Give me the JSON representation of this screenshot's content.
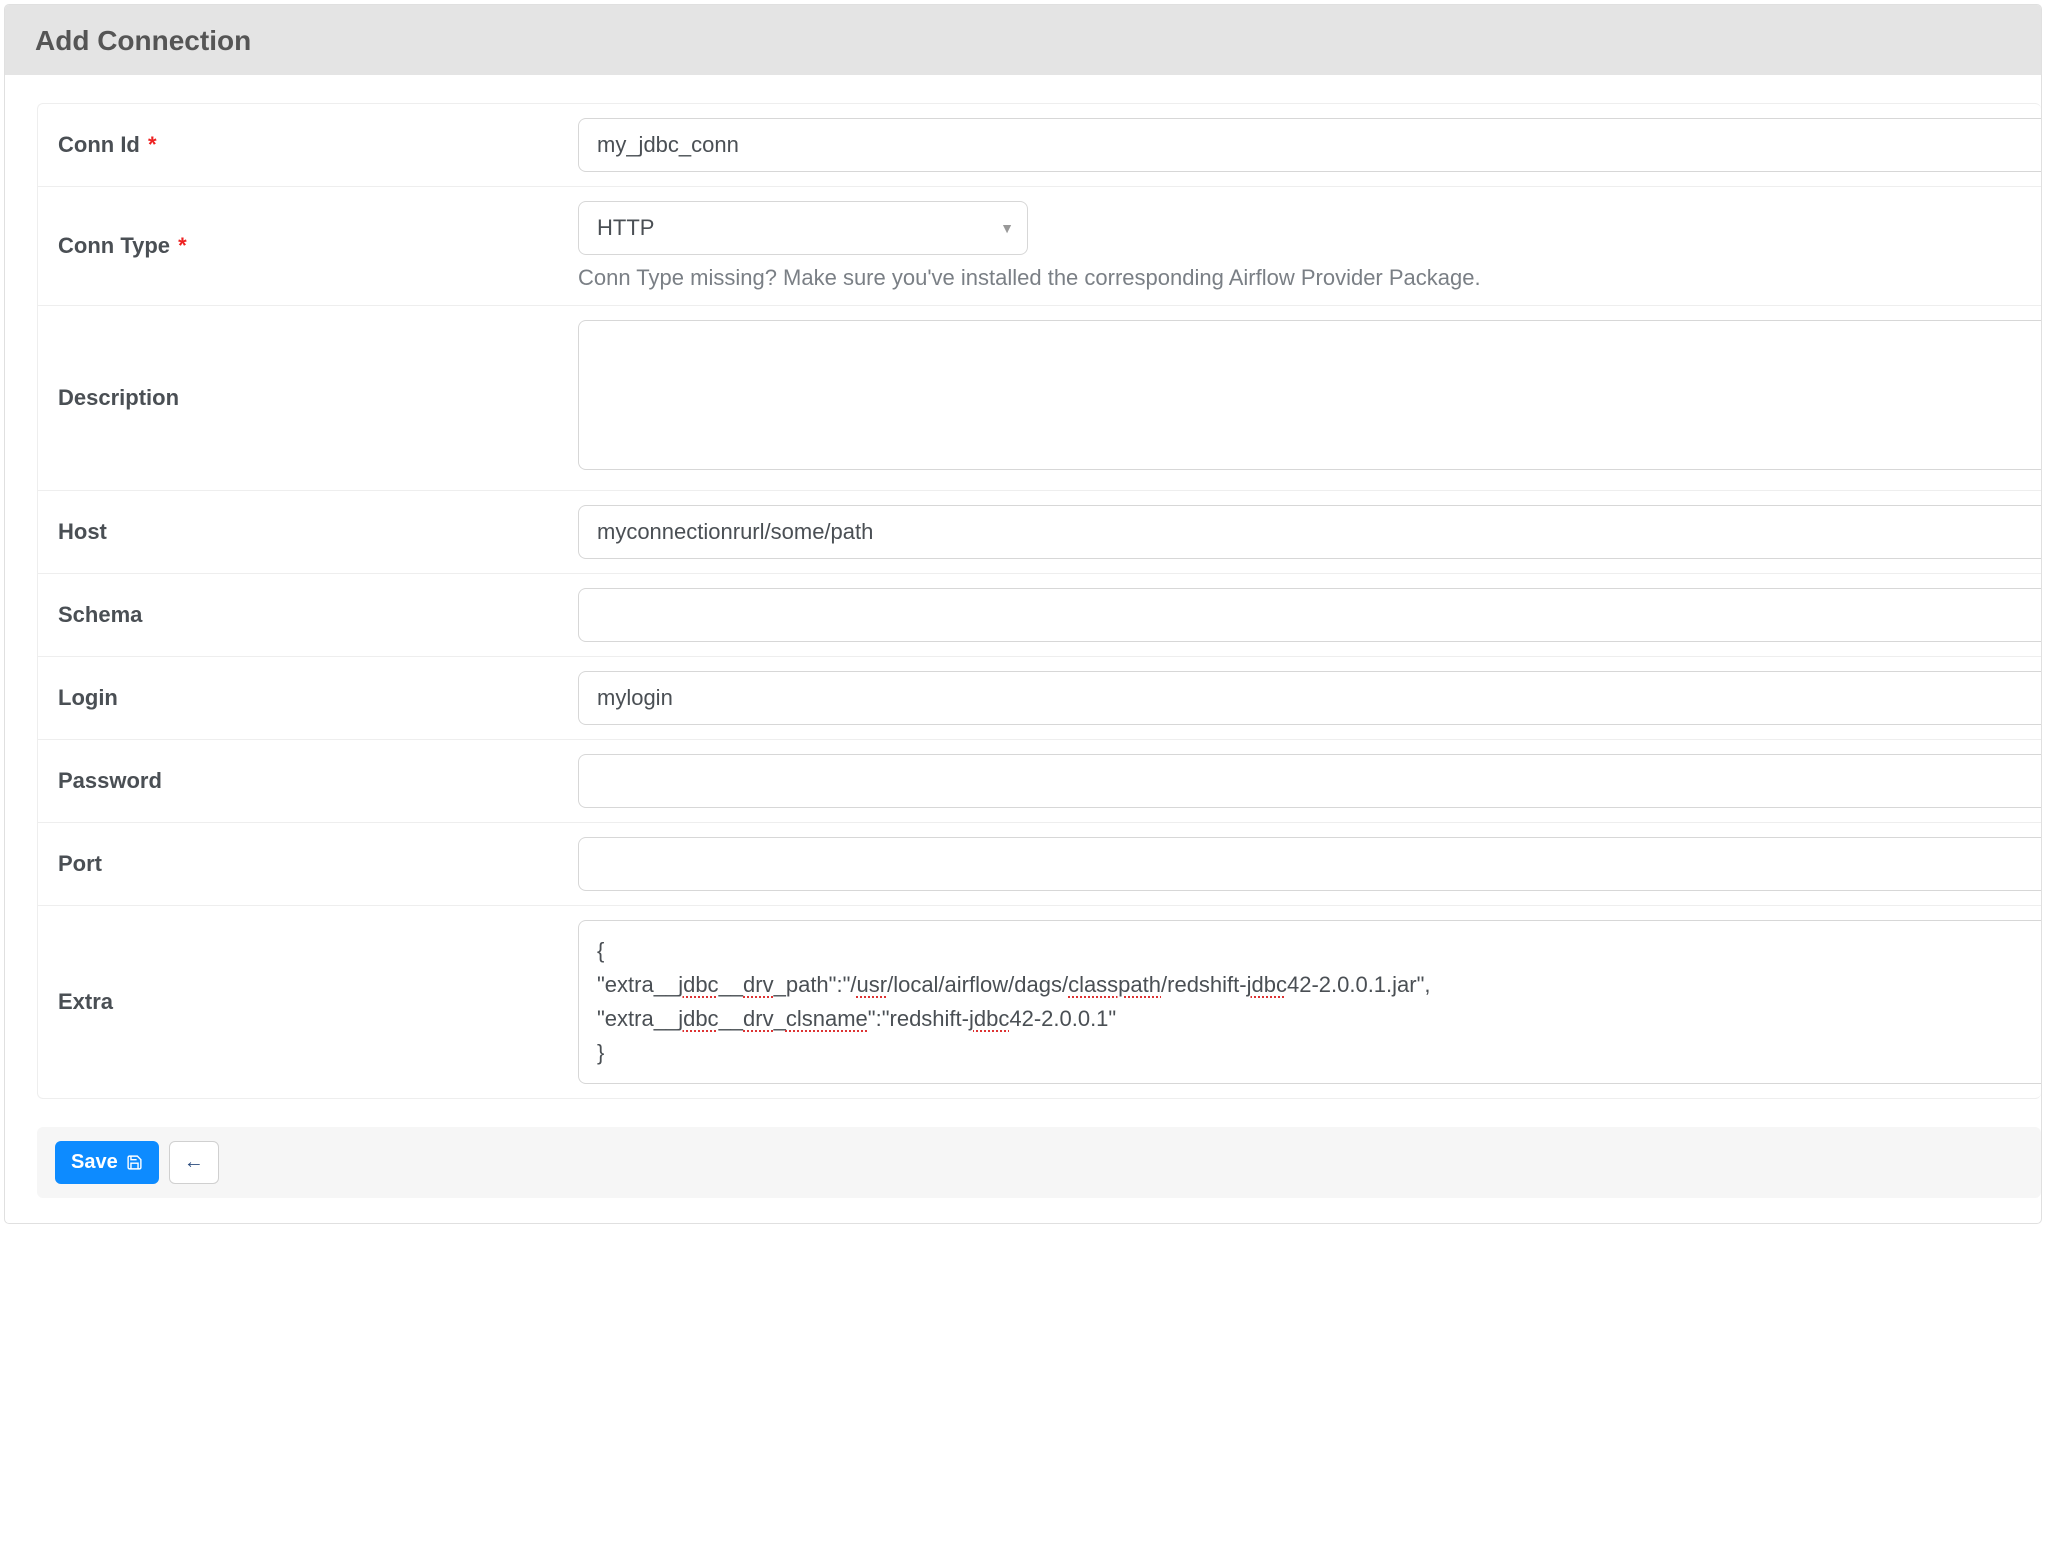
{
  "header": {
    "title": "Add Connection"
  },
  "fields": {
    "conn_id": {
      "label": "Conn Id",
      "required": true,
      "value": "my_jdbc_conn"
    },
    "conn_type": {
      "label": "Conn Type",
      "required": true,
      "value": "HTTP",
      "help": "Conn Type missing? Make sure you've installed the corresponding Airflow Provider Package."
    },
    "description": {
      "label": "Description",
      "required": false,
      "value": ""
    },
    "host": {
      "label": "Host",
      "required": false,
      "value": "myconnectionrurl/some/path"
    },
    "schema": {
      "label": "Schema",
      "required": false,
      "value": ""
    },
    "login": {
      "label": "Login",
      "required": false,
      "value": "mylogin"
    },
    "password": {
      "label": "Password",
      "required": false,
      "value": ""
    },
    "port": {
      "label": "Port",
      "required": false,
      "value": ""
    },
    "extra": {
      "label": "Extra",
      "required": false,
      "value": "{\n\"extra__jdbc__drv_path\":\"/usr/local/airflow/dags/classpath/redshift-jdbc42-2.0.0.1.jar\",\n\"extra__jdbc__drv_clsname\":\"redshift-jdbc42-2.0.0.1\"\n}"
    }
  },
  "footer": {
    "save_label": "Save",
    "back_label": "←"
  },
  "required_marker": "*"
}
